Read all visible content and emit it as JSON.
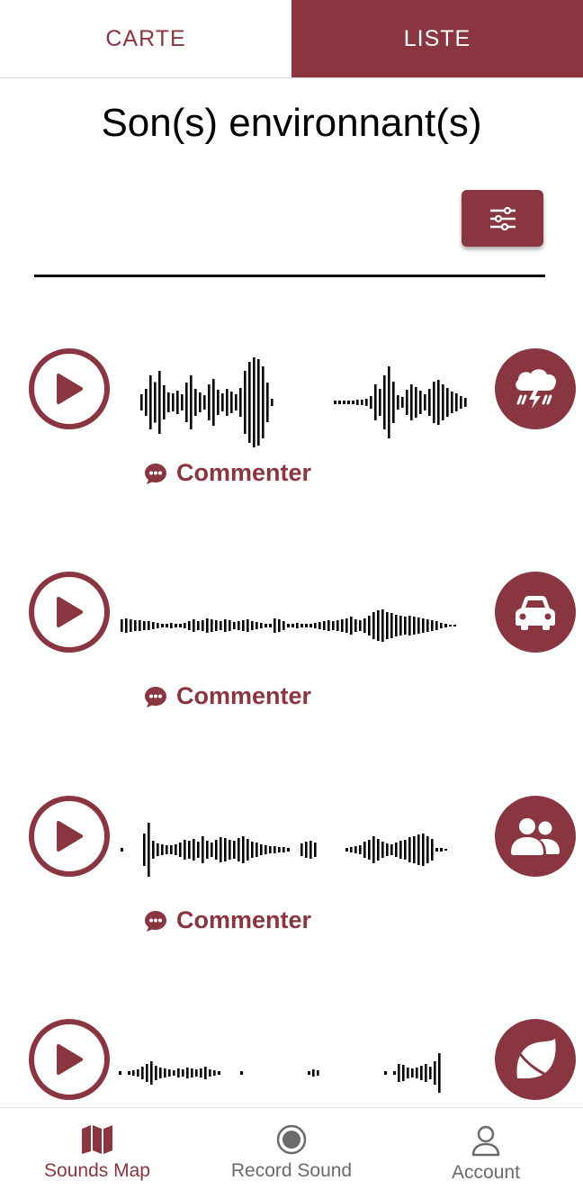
{
  "tabs": {
    "map_label": "CARTE",
    "list_label": "LISTE",
    "active": "list"
  },
  "page": {
    "title": "Son(s) environnant(s)"
  },
  "filter": {
    "icon": "sliders-icon"
  },
  "sounds": [
    {
      "comment_label": "Commenter",
      "category_icon": "thunderstorm-icon"
    },
    {
      "comment_label": "Commenter",
      "category_icon": "car-icon"
    },
    {
      "comment_label": "Commenter",
      "category_icon": "people-icon"
    },
    {
      "comment_label": "",
      "category_icon": "leaf-icon"
    }
  ],
  "nav": {
    "items": [
      {
        "label": "Sounds Map",
        "icon": "map-icon",
        "active": true
      },
      {
        "label": "Record Sound",
        "icon": "record-icon",
        "active": false
      },
      {
        "label": "Account",
        "icon": "person-icon",
        "active": false
      }
    ]
  },
  "colors": {
    "accent": "#8a3640",
    "inactive": "#6b6b6b"
  }
}
